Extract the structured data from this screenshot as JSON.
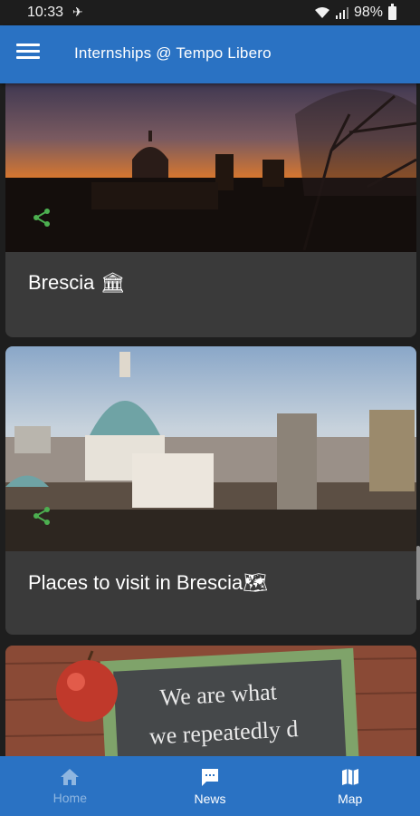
{
  "status_bar": {
    "time": "10:33",
    "battery": "98%"
  },
  "app_bar": {
    "title": "Internships @ Tempo Libero"
  },
  "cards": [
    {
      "title": "Brescia",
      "emoji": "🏛"
    },
    {
      "title": "Places to visit in Brescia",
      "emoji": "🗺"
    },
    {
      "image_text_line1": "We are what",
      "image_text_line2": "we repeatedly d"
    }
  ],
  "bottom_nav": {
    "items": [
      {
        "label": "Home",
        "icon": "home-icon"
      },
      {
        "label": "News",
        "icon": "chat-icon"
      },
      {
        "label": "Map",
        "icon": "map-icon"
      }
    ]
  },
  "colors": {
    "primary": "#2a72c3",
    "card_bg": "#3a3a3a",
    "share": "#4caf50"
  }
}
